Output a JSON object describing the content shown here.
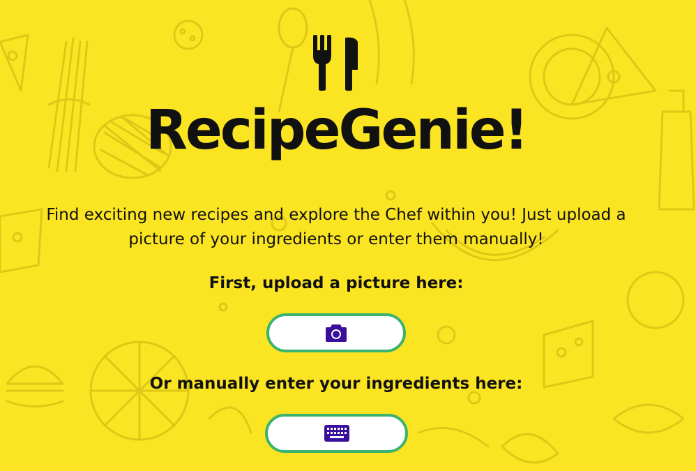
{
  "app": {
    "title": "RecipeGenie!",
    "logo_icon": "fork-and-knife-icon"
  },
  "tagline": "Find exciting new recipes and explore the Chef within you! Just upload a picture of your ingredients or enter them manually!",
  "upload": {
    "label": "First, upload a picture here:",
    "button_icon": "camera-icon"
  },
  "manual": {
    "label": "Or manually enter your ingredients here:",
    "button_icon": "keyboard-icon"
  },
  "colors": {
    "background": "#fbe522",
    "doodle": "#d9c415",
    "button_border": "#3bb36e",
    "button_fill": "#ffffff",
    "icon": "#3a0f9e",
    "text": "#111111"
  }
}
